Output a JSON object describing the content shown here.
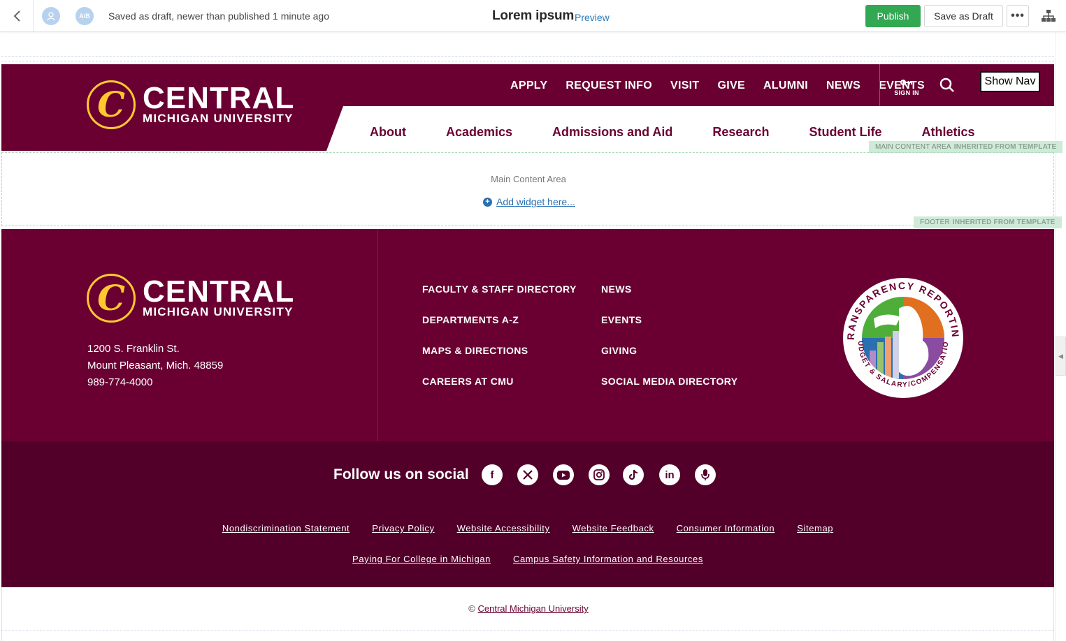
{
  "toolbar": {
    "avatar2_initials": "A/B",
    "status": "Saved as draft, newer than published 1 minute ago",
    "title": "Lorem ipsum",
    "preview_label": "Preview",
    "publish_label": "Publish",
    "save_draft_label": "Save as Draft",
    "more_label": "•••"
  },
  "header": {
    "logo_line1": "CENTRAL",
    "logo_line2": "MICHIGAN UNIVERSITY",
    "util_nav": [
      "APPLY",
      "REQUEST INFO",
      "VISIT",
      "GIVE",
      "ALUMNI",
      "NEWS",
      "EVENTS"
    ],
    "signin_label": "SIGN IN",
    "show_nav_label": "Show Nav",
    "main_nav": [
      "About",
      "Academics",
      "Admissions and Aid",
      "Research",
      "Student Life",
      "Athletics"
    ]
  },
  "template_labels": {
    "main": {
      "name": "MAIN CONTENT AREA",
      "note": "INHERITED FROM TEMPLATE"
    },
    "footer": {
      "name": "FOOTER",
      "note": "INHERITED FROM TEMPLATE"
    }
  },
  "main_area": {
    "title": "Main Content Area",
    "add_widget": "Add widget here..."
  },
  "footer": {
    "address": [
      "1200 S. Franklin St.",
      "Mount Pleasant, Mich. 48859",
      "989-774-4000"
    ],
    "links_col1": [
      "FACULTY & STAFF DIRECTORY",
      "DEPARTMENTS A-Z",
      "MAPS & DIRECTIONS",
      "CAREERS AT CMU"
    ],
    "links_col2": [
      "NEWS",
      "EVENTS",
      "GIVING",
      "SOCIAL MEDIA DIRECTORY"
    ],
    "seal_top": "TRANSPARENCY REPORTING",
    "seal_bottom": "BUDGET & SALARY/COMPENSATION",
    "social_label": "Follow us on social",
    "social_icons": [
      "facebook-icon",
      "x-icon",
      "youtube-icon",
      "instagram-icon",
      "tiktok-icon",
      "linkedin-icon",
      "podcast-icon"
    ],
    "legal_row1": [
      "Nondiscrimination Statement",
      "Privacy Policy",
      "Website Accessibility",
      "Website Feedback",
      "Consumer Information",
      "Sitemap"
    ],
    "legal_row2": [
      "Paying For College in Michigan",
      "Campus Safety Information and Resources"
    ],
    "copyright_symbol": "©",
    "copyright_link": "Central Michigan University"
  },
  "colors": {
    "maroon": "#6a0032",
    "maroon_dark": "#52002a",
    "gold": "#ffc82e",
    "publish_green": "#32a852",
    "link_blue": "#2a6fb0"
  }
}
